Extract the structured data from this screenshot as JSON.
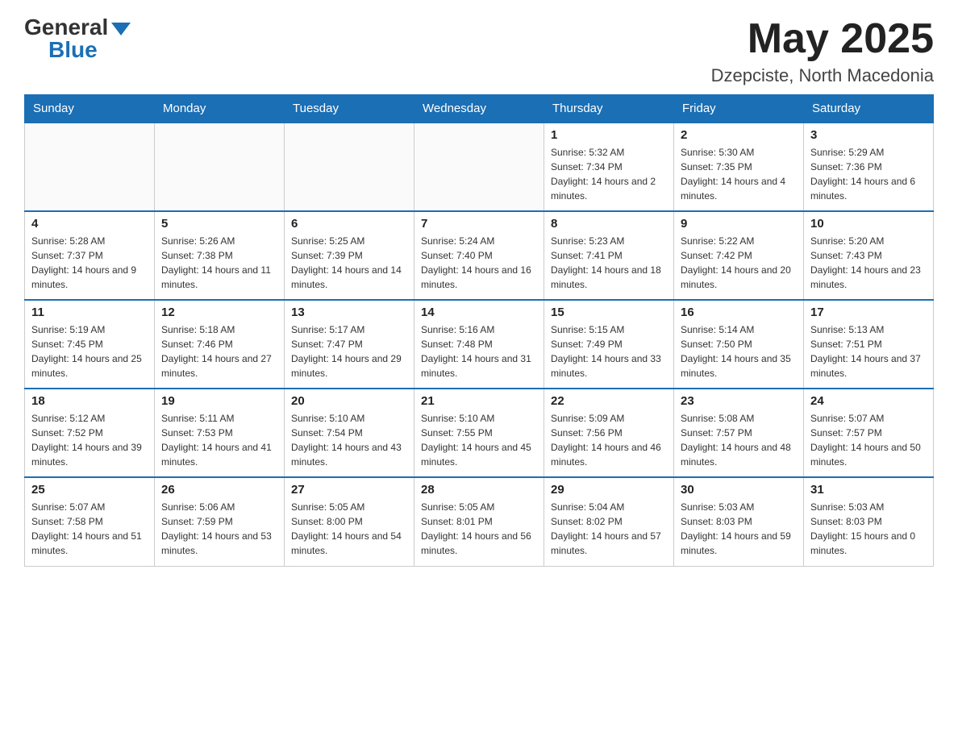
{
  "header": {
    "logo_general": "General",
    "logo_blue": "Blue",
    "month_title": "May 2025",
    "location": "Dzepciste, North Macedonia"
  },
  "days_of_week": [
    "Sunday",
    "Monday",
    "Tuesday",
    "Wednesday",
    "Thursday",
    "Friday",
    "Saturday"
  ],
  "weeks": [
    [
      {
        "day": "",
        "info": ""
      },
      {
        "day": "",
        "info": ""
      },
      {
        "day": "",
        "info": ""
      },
      {
        "day": "",
        "info": ""
      },
      {
        "day": "1",
        "info": "Sunrise: 5:32 AM\nSunset: 7:34 PM\nDaylight: 14 hours and 2 minutes."
      },
      {
        "day": "2",
        "info": "Sunrise: 5:30 AM\nSunset: 7:35 PM\nDaylight: 14 hours and 4 minutes."
      },
      {
        "day": "3",
        "info": "Sunrise: 5:29 AM\nSunset: 7:36 PM\nDaylight: 14 hours and 6 minutes."
      }
    ],
    [
      {
        "day": "4",
        "info": "Sunrise: 5:28 AM\nSunset: 7:37 PM\nDaylight: 14 hours and 9 minutes."
      },
      {
        "day": "5",
        "info": "Sunrise: 5:26 AM\nSunset: 7:38 PM\nDaylight: 14 hours and 11 minutes."
      },
      {
        "day": "6",
        "info": "Sunrise: 5:25 AM\nSunset: 7:39 PM\nDaylight: 14 hours and 14 minutes."
      },
      {
        "day": "7",
        "info": "Sunrise: 5:24 AM\nSunset: 7:40 PM\nDaylight: 14 hours and 16 minutes."
      },
      {
        "day": "8",
        "info": "Sunrise: 5:23 AM\nSunset: 7:41 PM\nDaylight: 14 hours and 18 minutes."
      },
      {
        "day": "9",
        "info": "Sunrise: 5:22 AM\nSunset: 7:42 PM\nDaylight: 14 hours and 20 minutes."
      },
      {
        "day": "10",
        "info": "Sunrise: 5:20 AM\nSunset: 7:43 PM\nDaylight: 14 hours and 23 minutes."
      }
    ],
    [
      {
        "day": "11",
        "info": "Sunrise: 5:19 AM\nSunset: 7:45 PM\nDaylight: 14 hours and 25 minutes."
      },
      {
        "day": "12",
        "info": "Sunrise: 5:18 AM\nSunset: 7:46 PM\nDaylight: 14 hours and 27 minutes."
      },
      {
        "day": "13",
        "info": "Sunrise: 5:17 AM\nSunset: 7:47 PM\nDaylight: 14 hours and 29 minutes."
      },
      {
        "day": "14",
        "info": "Sunrise: 5:16 AM\nSunset: 7:48 PM\nDaylight: 14 hours and 31 minutes."
      },
      {
        "day": "15",
        "info": "Sunrise: 5:15 AM\nSunset: 7:49 PM\nDaylight: 14 hours and 33 minutes."
      },
      {
        "day": "16",
        "info": "Sunrise: 5:14 AM\nSunset: 7:50 PM\nDaylight: 14 hours and 35 minutes."
      },
      {
        "day": "17",
        "info": "Sunrise: 5:13 AM\nSunset: 7:51 PM\nDaylight: 14 hours and 37 minutes."
      }
    ],
    [
      {
        "day": "18",
        "info": "Sunrise: 5:12 AM\nSunset: 7:52 PM\nDaylight: 14 hours and 39 minutes."
      },
      {
        "day": "19",
        "info": "Sunrise: 5:11 AM\nSunset: 7:53 PM\nDaylight: 14 hours and 41 minutes."
      },
      {
        "day": "20",
        "info": "Sunrise: 5:10 AM\nSunset: 7:54 PM\nDaylight: 14 hours and 43 minutes."
      },
      {
        "day": "21",
        "info": "Sunrise: 5:10 AM\nSunset: 7:55 PM\nDaylight: 14 hours and 45 minutes."
      },
      {
        "day": "22",
        "info": "Sunrise: 5:09 AM\nSunset: 7:56 PM\nDaylight: 14 hours and 46 minutes."
      },
      {
        "day": "23",
        "info": "Sunrise: 5:08 AM\nSunset: 7:57 PM\nDaylight: 14 hours and 48 minutes."
      },
      {
        "day": "24",
        "info": "Sunrise: 5:07 AM\nSunset: 7:57 PM\nDaylight: 14 hours and 50 minutes."
      }
    ],
    [
      {
        "day": "25",
        "info": "Sunrise: 5:07 AM\nSunset: 7:58 PM\nDaylight: 14 hours and 51 minutes."
      },
      {
        "day": "26",
        "info": "Sunrise: 5:06 AM\nSunset: 7:59 PM\nDaylight: 14 hours and 53 minutes."
      },
      {
        "day": "27",
        "info": "Sunrise: 5:05 AM\nSunset: 8:00 PM\nDaylight: 14 hours and 54 minutes."
      },
      {
        "day": "28",
        "info": "Sunrise: 5:05 AM\nSunset: 8:01 PM\nDaylight: 14 hours and 56 minutes."
      },
      {
        "day": "29",
        "info": "Sunrise: 5:04 AM\nSunset: 8:02 PM\nDaylight: 14 hours and 57 minutes."
      },
      {
        "day": "30",
        "info": "Sunrise: 5:03 AM\nSunset: 8:03 PM\nDaylight: 14 hours and 59 minutes."
      },
      {
        "day": "31",
        "info": "Sunrise: 5:03 AM\nSunset: 8:03 PM\nDaylight: 15 hours and 0 minutes."
      }
    ]
  ]
}
